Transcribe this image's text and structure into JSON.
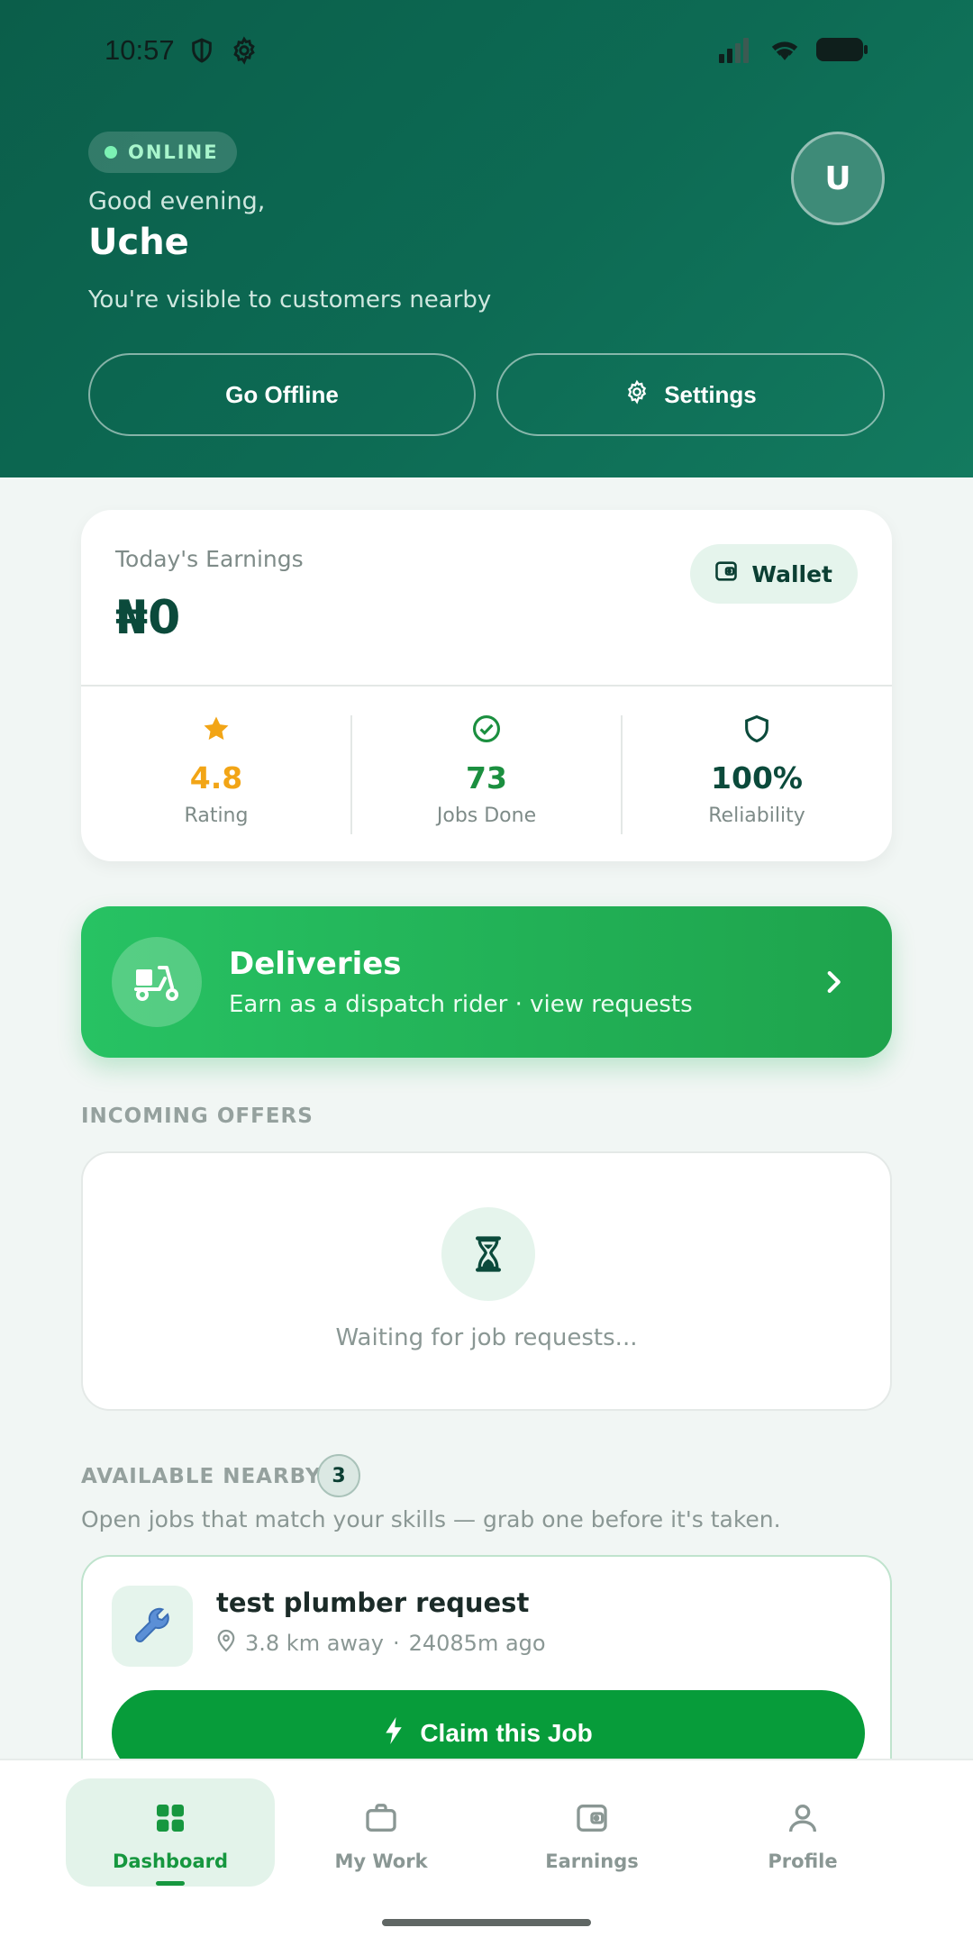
{
  "status_bar": {
    "time": "10:57"
  },
  "header": {
    "status": "ONLINE",
    "greeting": "Good evening,",
    "name": "Uche",
    "subtitle": "You're visible to customers nearby",
    "avatar_initial": "U",
    "go_offline_label": "Go Offline",
    "settings_label": "Settings"
  },
  "earnings": {
    "label": "Today's Earnings",
    "value": "₦0",
    "wallet_label": "Wallet",
    "stats": [
      {
        "value": "4.8",
        "label": "Rating",
        "color": "#f2a516",
        "icon": "star-icon"
      },
      {
        "value": "73",
        "label": "Jobs Done",
        "color": "#1b8f3f",
        "icon": "check-circle-icon"
      },
      {
        "value": "100%",
        "label": "Reliability",
        "color": "#0b4a3b",
        "icon": "shield-icon"
      }
    ]
  },
  "deliveries": {
    "title": "Deliveries",
    "subtitle": "Earn as a dispatch rider · view requests"
  },
  "incoming_offers": {
    "title": "INCOMING OFFERS",
    "empty_text": "Waiting for job requests..."
  },
  "available_nearby": {
    "title": "AVAILABLE NEARBY",
    "count": "3",
    "subtitle": "Open jobs that match your skills — grab one before it's taken.",
    "jobs": [
      {
        "title": "test plumber request",
        "distance": "3.8 km away",
        "separator": "·",
        "age": "24085m ago",
        "claim_label": "Claim this Job"
      }
    ]
  },
  "nav": {
    "items": [
      {
        "label": "Dashboard",
        "icon": "grid-icon"
      },
      {
        "label": "My Work",
        "icon": "briefcase-icon"
      },
      {
        "label": "Earnings",
        "icon": "wallet-icon"
      },
      {
        "label": "Profile",
        "icon": "person-icon"
      }
    ]
  },
  "colors": {
    "brand_dark": "#0b5e4a",
    "accent_green": "#079c3a",
    "banner_green": "#27c263"
  }
}
